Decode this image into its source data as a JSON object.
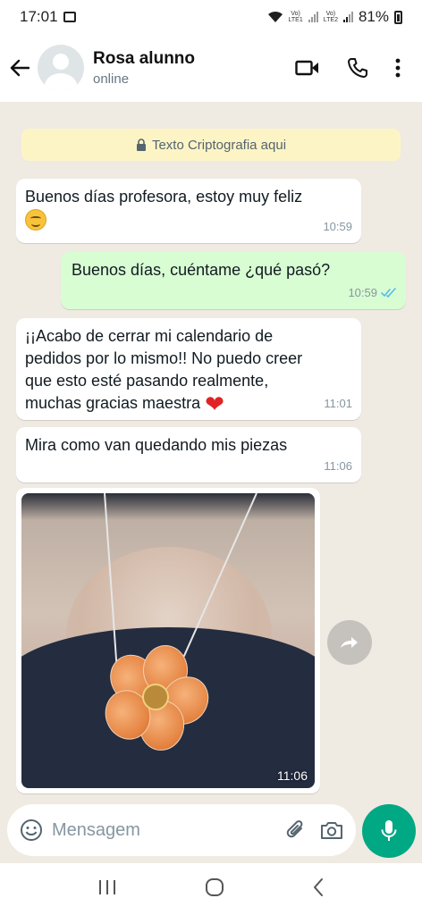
{
  "status_bar": {
    "time": "17:01",
    "sim1": "VoLTE1",
    "sim2": "VoLTE2",
    "battery": "81%"
  },
  "header": {
    "contact_name": "Rosa alunno",
    "contact_status": "online"
  },
  "encryption_notice": "Texto Criptografia aqui",
  "messages": [
    {
      "direction": "in",
      "text": "Buenos días profesora, estoy muy feliz",
      "emoji": "smiling-face",
      "time": "10:59"
    },
    {
      "direction": "out",
      "text": "Buenos días, cuéntame ¿qué pasó?",
      "time": "10:59",
      "read": true
    },
    {
      "direction": "in",
      "text": "¡¡Acabo de cerrar mi calendario de pedidos por lo mismo!! No puedo creer que esto esté pasando realmente, muchas gracias maestra",
      "emoji": "red-heart",
      "time": "11:01"
    },
    {
      "direction": "in",
      "text": "Mira como van quedando mis piezas",
      "time": "11:06"
    },
    {
      "direction": "in",
      "type": "image",
      "time": "11:06"
    }
  ],
  "input": {
    "placeholder": "Mensagem"
  },
  "colors": {
    "accent": "#00a884",
    "chat_bg": "#efeae2",
    "outgoing_bubble": "#d9fdd3",
    "incoming_bubble": "#ffffff",
    "read_ticks": "#53bdeb"
  }
}
